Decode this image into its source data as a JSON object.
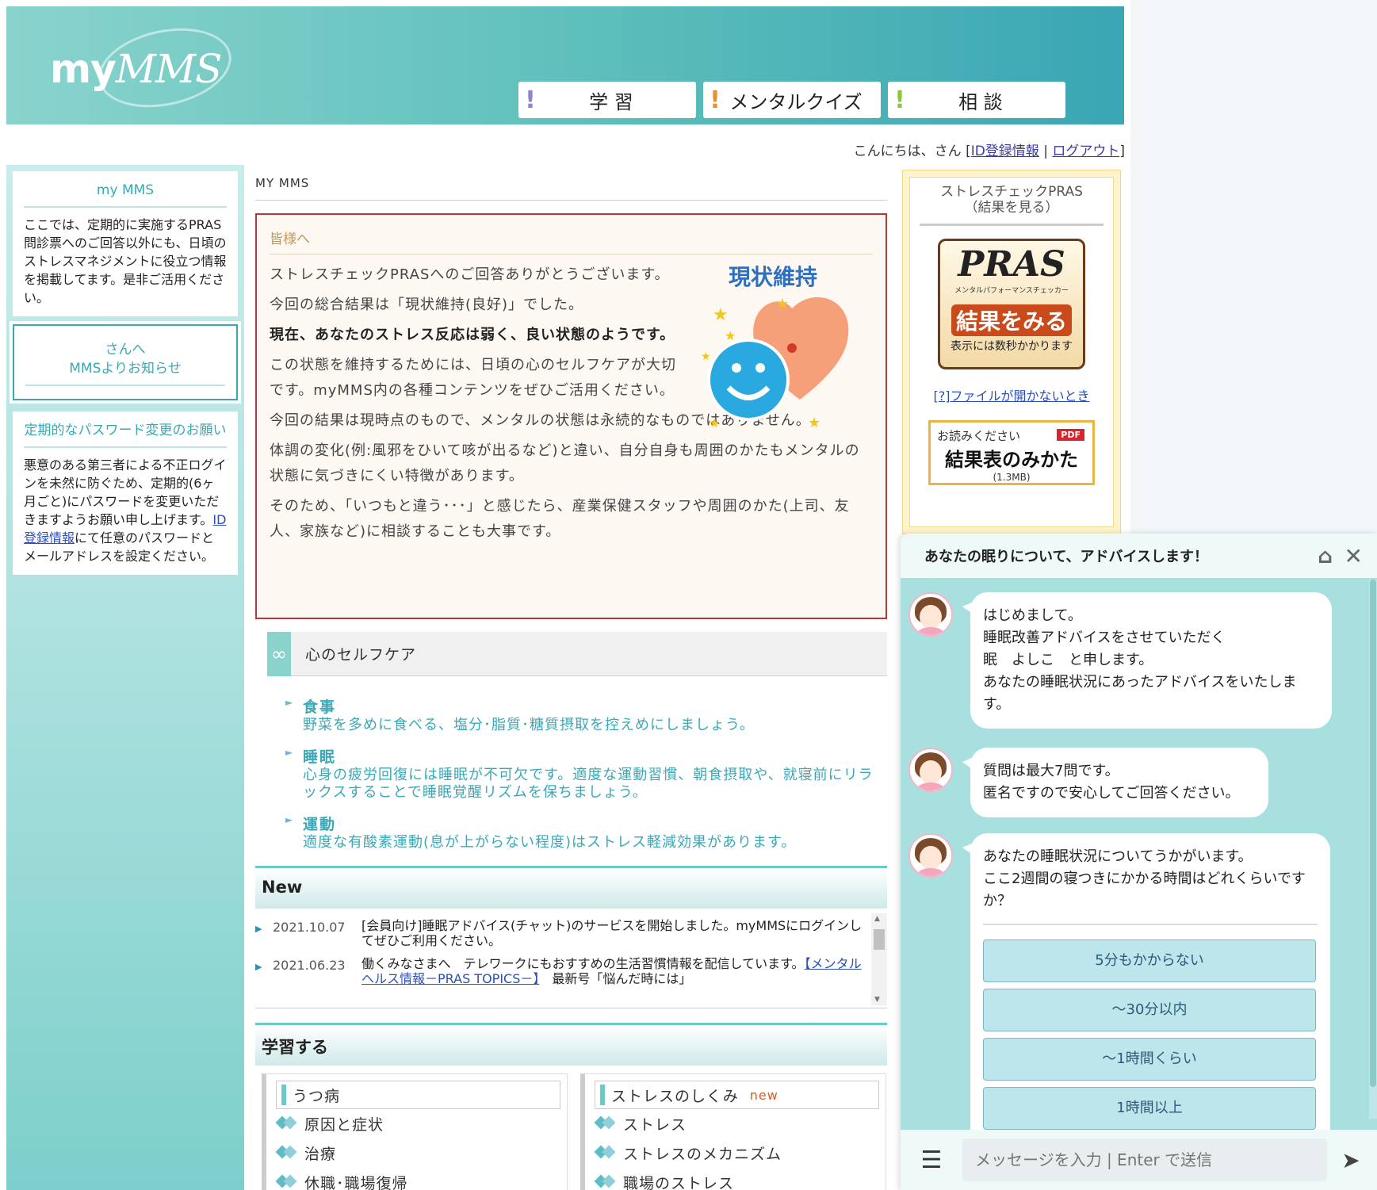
{
  "header": {
    "logo_prefix": "my",
    "logo_mms": "MMS",
    "nav": [
      {
        "label": "学 習",
        "bang_color": "#8a86c8"
      },
      {
        "label": "メンタルクイズ",
        "bang_color": "#e8902a"
      },
      {
        "label": "相 談",
        "bang_color": "#8cc63e"
      }
    ]
  },
  "greeting": {
    "text": "こんにちは、さん ",
    "open": "[",
    "id_link": "ID登録情報",
    "sep": " | ",
    "logout": "ログアウト",
    "close": "]"
  },
  "sidebar": {
    "box1": {
      "title": "my MMS",
      "text": "ここでは、定期的に実施するPRAS問診票へのご回答以外にも、日頃のストレスマネジメントに役立つ情報を掲載してます。是非ご活用ください。"
    },
    "box2": {
      "line1": "さんへ",
      "line2": "MMSよりお知らせ"
    },
    "box3": {
      "title": "定期的なパスワード変更のお願い",
      "text_before": "悪意のある第三者による不正ログインを未然に防ぐため、定期的(6ヶ月ごと)にパスワードを変更いただきますようお願い申し上げます。",
      "link": "ID登録情報",
      "text_after": "にて任意のパスワードとメールアドレスを設定ください。"
    }
  },
  "main": {
    "breadcrumb": "MY MMS",
    "notice": {
      "title": "皆様へ",
      "badge": "現状維持",
      "p1": "ストレスチェックPRASへのご回答ありがとうございます。",
      "p2": "今回の総合結果は「現状維持(良好)」でした。",
      "p3": "現在、あなたのストレス反応は弱く、良い状態のようです。",
      "p4": "この状態を維持するためには、日頃の心のセルフケアが大切です。myMMS内の各種コンテンツをぜひご活用ください。",
      "p5": "今回の結果は現時点のもので、メンタルの状態は永続的なものではありません。",
      "p6": "体調の変化(例:風邪をひいて咳が出るなど)と違い、自分自身も周囲のかたもメンタルの状態に気づきにくい特徴があります。",
      "p7": "そのため、「いつもと違う･･･」と感じたら、産業保健スタッフや周囲のかた(上司、友人、家族など)に相談することも大事です。"
    },
    "selfcare": {
      "icon": "∞",
      "title": "心のセルフケア",
      "items": [
        {
          "h": "食事",
          "d": "野菜を多めに食べる、塩分･脂質･糖質摂取を控えめにしましょう。"
        },
        {
          "h": "睡眠",
          "d": "心身の疲労回復には睡眠が不可欠です。適度な運動習慣、朝食摂取や、就寝前にリラックスすることで睡眠覚醒リズムを保ちましょう。"
        },
        {
          "h": "運動",
          "d": "適度な有酸素運動(息が上がらない程度)はストレス軽減効果があります。"
        }
      ]
    },
    "news": {
      "title": "New",
      "items": [
        {
          "date": "2021.10.07",
          "text": "[会員向け]睡眠アドバイス(チャット)のサービスを開始しました。myMMSにログインしてぜひご利用ください。",
          "link": "",
          "after": ""
        },
        {
          "date": "2021.06.23",
          "text": "働くみなさまへ　テレワークにもおすすめの生活習慣情報を配信しています。",
          "link": "【メンタルヘルス情報－PRAS TOPICS－】",
          "after": "　最新号「悩んだ時には」"
        }
      ]
    },
    "study": {
      "title": "学習する",
      "col1": {
        "head": "うつ病",
        "items": [
          "原因と症状",
          "治療",
          "休職･職場復帰"
        ]
      },
      "col2": {
        "head": "ストレスのしくみ",
        "new": "new",
        "items": [
          "ストレス",
          "ストレスのメカニズム",
          "職場のストレス"
        ]
      }
    }
  },
  "right": {
    "title1": "ストレスチェックPRAS",
    "title2": "（結果を見る）",
    "pras_logo": "PRAS",
    "pras_sub": "メンタルパフォーマンスチェッカー",
    "pras_go": "結果をみる",
    "pras_note": "表示には数秒かかります",
    "link": "[?]ファイルが開かないとき",
    "pdf_top": "お読みください",
    "pdf_tag": "PDF",
    "pdf_main": "結果表のみかた",
    "pdf_size": "(1.3MB)"
  },
  "chat": {
    "title": "あなたの眠りについて、アドバイスします！",
    "msg1": [
      "はじめまして。",
      "睡眠改善アドバイスをさせていただく",
      "眠　よしこ　と申します。",
      "あなたの睡眠状況にあったアドバイスをいたします。"
    ],
    "msg2": [
      "質問は最大7問です。",
      "匿名ですので安心してご回答ください。"
    ],
    "msg3": [
      "あなたの睡眠状況についてうかがいます。",
      "ここ2週間の寝つきにかかる時間はどれくらいですか？"
    ],
    "choices": [
      "5分もかからない",
      "～30分以内",
      "～1時間くらい",
      "1時間以上"
    ],
    "placeholder": "メッセージを入力 | Enter で送信"
  }
}
